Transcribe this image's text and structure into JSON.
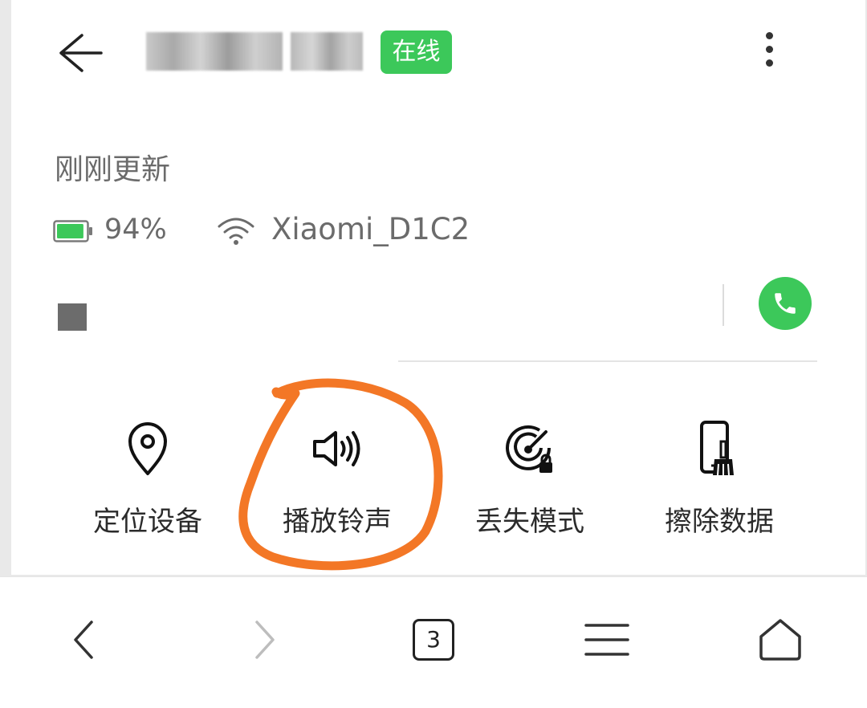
{
  "header": {
    "device_name": "",
    "status_badge": "在线",
    "status_color": "#3cc85a"
  },
  "info": {
    "updated_text": "刚刚更新",
    "battery_percent": "94%",
    "battery_level": 0.94,
    "wifi_name": "Xiaomi_D1C2"
  },
  "actions": [
    {
      "label": "定位设备",
      "icon": "location-pin-icon"
    },
    {
      "label": "播放铃声",
      "icon": "speaker-icon"
    },
    {
      "label": "丢失模式",
      "icon": "radar-lock-icon"
    },
    {
      "label": "擦除数据",
      "icon": "phone-broom-icon"
    }
  ],
  "annotation": {
    "color": "#f37726"
  },
  "bottom_nav": {
    "tab_count": "3"
  }
}
